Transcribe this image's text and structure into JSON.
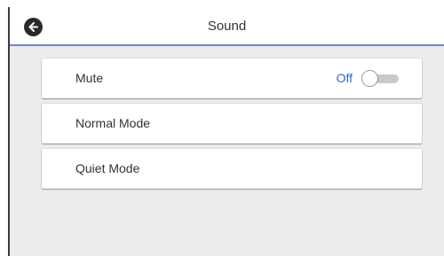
{
  "header": {
    "title": "Sound",
    "back_icon": "back-arrow-icon"
  },
  "settings": {
    "items": [
      {
        "label": "Mute",
        "value": "Off",
        "toggle_on": false
      },
      {
        "label": "Normal Mode"
      },
      {
        "label": "Quiet Mode"
      }
    ]
  },
  "colors": {
    "header_rule": "#6b8ab8",
    "value_text": "#2b69c9",
    "background": "#ececec"
  }
}
